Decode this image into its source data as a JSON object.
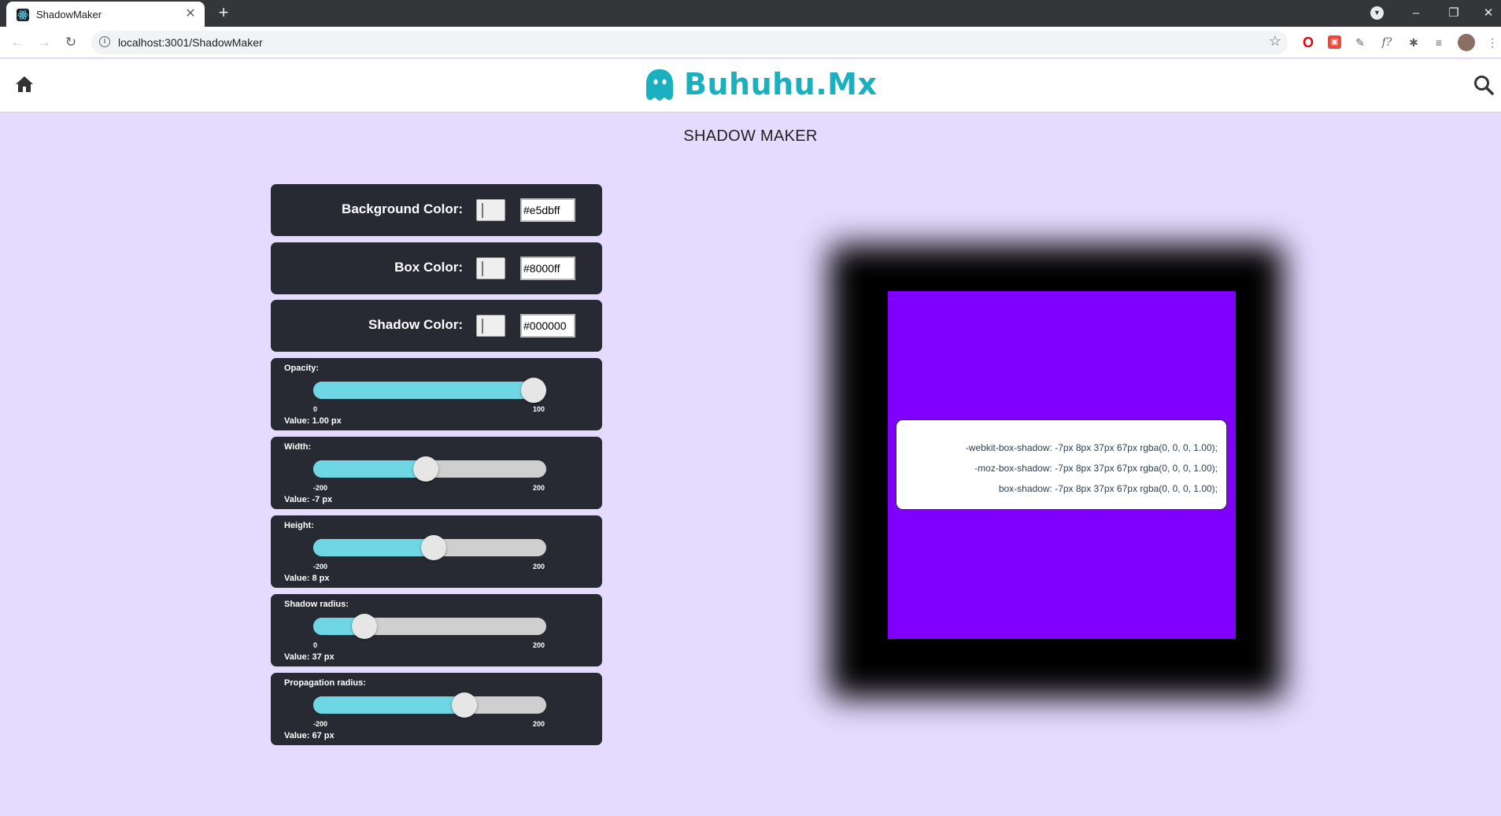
{
  "browser": {
    "tab_title": "ShadowMaker",
    "tab_close": "✕",
    "new_tab": "+",
    "url": "localhost:3001/ShadowMaker",
    "window_controls": {
      "minimize": "–",
      "restore": "❐",
      "close": "✕"
    }
  },
  "site": {
    "brand": "Buhuhu.Mx",
    "brand_color": "#1ab0bf"
  },
  "page_title": "SHADOW MAKER",
  "colors": [
    {
      "label": "Background Color:",
      "value": "#e5dbff"
    },
    {
      "label": "Box Color:",
      "value": "#8000ff"
    },
    {
      "label": "Shadow Color:",
      "value": "#000000"
    }
  ],
  "sliders": [
    {
      "label": "Opacity:",
      "min": "0",
      "max": "100",
      "value_text": "Value: 1.00 px",
      "value": 100,
      "min_num": 0,
      "max_num": 100
    },
    {
      "label": "Width:",
      "min": "-200",
      "max": "200",
      "value_text": "Value: -7 px",
      "value": -7,
      "min_num": -200,
      "max_num": 200
    },
    {
      "label": "Height:",
      "min": "-200",
      "max": "200",
      "value_text": "Value: 8 px",
      "value": 8,
      "min_num": -200,
      "max_num": 200
    },
    {
      "label": "Shadow radius:",
      "min": "0",
      "max": "200",
      "value_text": "Value: 37 px",
      "value": 37,
      "min_num": 0,
      "max_num": 200
    },
    {
      "label": "Propagation radius:",
      "min": "-200",
      "max": "200",
      "value_text": "Value: 67 px",
      "value": 67,
      "min_num": -200,
      "max_num": 200
    }
  ],
  "code_lines": [
    "-webkit-box-shadow: -7px 8px 37px 67px rgba(0, 0, 0, 1.00);",
    "-moz-box-shadow: -7px 8px 37px 67px rgba(0, 0, 0, 1.00);",
    "box-shadow: -7px 8px 37px 67px rgba(0, 0, 0, 1.00);"
  ],
  "icons": [
    "react-favicon-icon",
    "home-icon",
    "search-icon",
    "ghost-logo-icon",
    "star-icon",
    "info-icon"
  ]
}
